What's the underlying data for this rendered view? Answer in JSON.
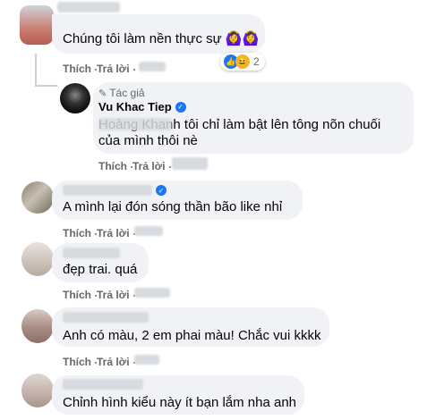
{
  "actions": {
    "like": "Thích",
    "reply": "Trả lời"
  },
  "reply_author": {
    "badge": "Tác giả",
    "name": "Vu Khac Tiep",
    "text_line1": "Hoàng Khanh tôi chỉ làm bật lên tông nõn chuối",
    "text_line2": "của mình thôi nè"
  },
  "comments": [
    {
      "text": "Chúng tôi làm nền thực sự 🙆‍♀️🙆‍♀️",
      "reaction_count": "2"
    },
    {
      "text": "A mình lại đón sóng thần bão like nhỉ"
    },
    {
      "text": "đẹp trai. quá"
    },
    {
      "text": "Anh có màu, 2 em phai màu! Chắc vui kkkk"
    },
    {
      "text": "Chỉnh hình kiểu này ít bạn lắm nha anh"
    }
  ],
  "colors": {
    "bubble": "#f0f2f5",
    "meta": "#65676b",
    "verified": "#1877f2"
  },
  "icons": [
    "pencil-icon",
    "verified-icon",
    "like-reaction-icon",
    "haha-reaction-icon"
  ]
}
